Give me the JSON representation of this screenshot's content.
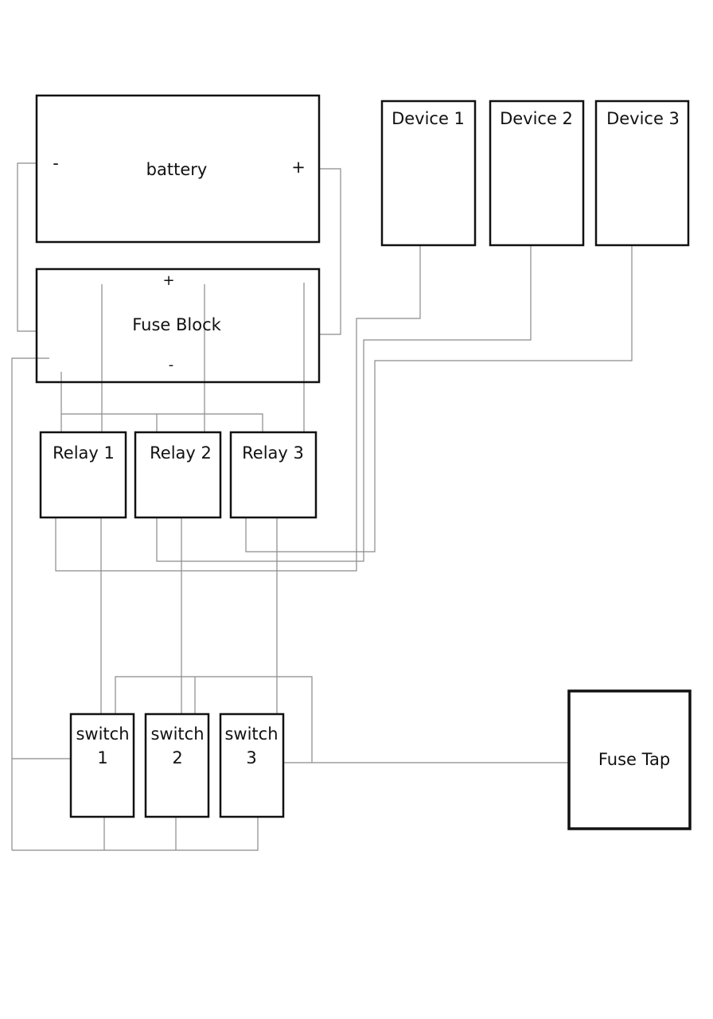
{
  "components": {
    "battery": {
      "label": "battery",
      "minus": "-",
      "plus": "+"
    },
    "fuse_block": {
      "label": "Fuse Block",
      "plus": "+",
      "minus": "-"
    },
    "devices": [
      {
        "label": "Device 1"
      },
      {
        "label": "Device 2"
      },
      {
        "label": "Device 3"
      }
    ],
    "relays": [
      {
        "label": "Relay 1"
      },
      {
        "label": "Relay 2"
      },
      {
        "label": "Relay 3"
      }
    ],
    "switches": [
      {
        "line1": "switch",
        "line2": "1"
      },
      {
        "line1": "switch",
        "line2": "2"
      },
      {
        "line1": "switch",
        "line2": "3"
      }
    ],
    "fuse_tap": {
      "label": "Fuse Tap"
    }
  }
}
